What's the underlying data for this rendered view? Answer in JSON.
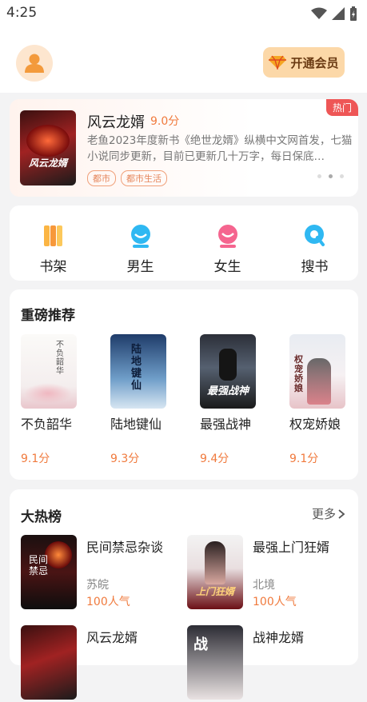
{
  "status": {
    "time": "4:25"
  },
  "header": {
    "vip_label": "开通会员"
  },
  "banner": {
    "hot_badge": "热门",
    "title": "风云龙婿",
    "score": "9.0分",
    "description": "老鱼2023年度新书《绝世龙婿》纵横中文网首发，七猫小说同步更新，目前已更新几十万字，每日保底…",
    "tags": [
      "都市",
      "都市生活"
    ],
    "cover_text": "风云龙婿"
  },
  "nav": [
    {
      "label": "书架",
      "icon": "bookshelf-icon"
    },
    {
      "label": "男生",
      "icon": "male-icon"
    },
    {
      "label": "女生",
      "icon": "female-icon"
    },
    {
      "label": "搜书",
      "icon": "search-book-icon"
    }
  ],
  "recommend": {
    "title": "重磅推荐",
    "books": [
      {
        "name": "不负韶华",
        "score": "9.1分",
        "cover_text": "不负韶华"
      },
      {
        "name": "陆地键仙",
        "score": "9.3分",
        "cover_text": "陆地键仙"
      },
      {
        "name": "最强战神",
        "score": "9.4分",
        "cover_text": "最强战神"
      },
      {
        "name": "权宠娇娘",
        "score": "9.1分",
        "cover_text": "权宠娇娘"
      }
    ]
  },
  "hot": {
    "title": "大热榜",
    "more": "更多",
    "items": [
      {
        "title": "民间禁忌杂谈",
        "author": "苏皖",
        "popularity": "100人气",
        "cover_text": "民间禁忌"
      },
      {
        "title": "最强上门狂婿",
        "author": "北境",
        "popularity": "100人气",
        "cover_text": "上门狂婿"
      },
      {
        "title": "风云龙婿",
        "author": "",
        "popularity": "",
        "cover_text": ""
      },
      {
        "title": "战神龙婿",
        "author": "",
        "popularity": "",
        "cover_text": "战"
      }
    ]
  }
}
